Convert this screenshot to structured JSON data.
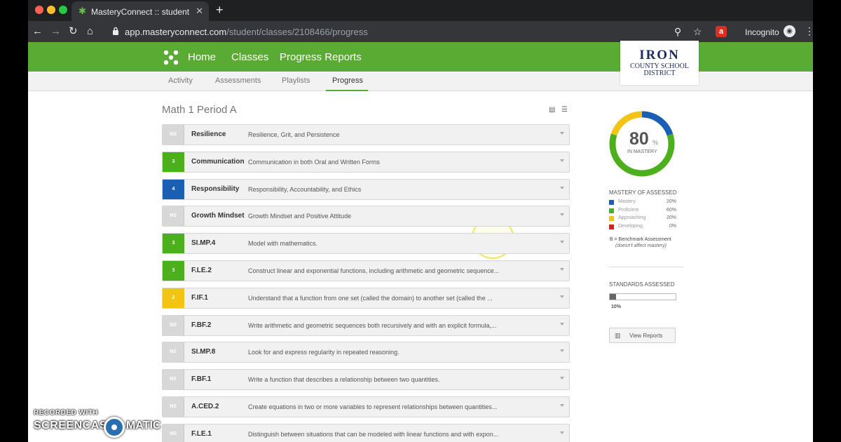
{
  "browser": {
    "tab_title": "MasteryConnect :: student_por",
    "url_host": "app.masteryconnect.com",
    "url_path": "/student/classes/2108466/progress",
    "profile_label": "Incognito"
  },
  "header": {
    "nav": [
      "Home",
      "Classes",
      "Progress Reports"
    ],
    "subnav": [
      "Activity",
      "Assessments",
      "Playlists",
      "Progress"
    ],
    "active_subnav": "Progress",
    "district_logo": {
      "line1": "IRON",
      "line2": "COUNTY SCHOOL",
      "line3": "DISTRICT"
    }
  },
  "main": {
    "class_title": "Math 1 Period A",
    "standards": [
      {
        "badge": "NS",
        "level": "ns",
        "code": "Resilience",
        "desc": "Resilience, Grit, and Persistence"
      },
      {
        "badge": "3",
        "level": "g3",
        "code": "Communication",
        "desc": "Communication in both Oral and Written Forms"
      },
      {
        "badge": "4",
        "level": "b4",
        "code": "Responsibility",
        "desc": "Responsibility, Accountability, and Ethics"
      },
      {
        "badge": "NS",
        "level": "ns",
        "code": "Growth Mindset",
        "desc": "Growth Mindset and Positive Attitude"
      },
      {
        "badge": "3",
        "level": "g3",
        "code": "SI.MP.4",
        "desc": "Model with mathematics."
      },
      {
        "badge": "3",
        "level": "g3",
        "code": "F.LE.2",
        "desc": "Construct linear and exponential functions, including arithmetic and geometric sequence..."
      },
      {
        "badge": "2",
        "level": "y2",
        "code": "F.IF.1",
        "desc": "Understand that a function from one set (called the domain) to another set (called the ..."
      },
      {
        "badge": "NS",
        "level": "ns",
        "code": "F.BF.2",
        "desc": "Write arithmetic and geometric sequences both recursively and with an explicit formula,..."
      },
      {
        "badge": "NS",
        "level": "ns",
        "code": "SI.MP.8",
        "desc": "Look for and express regularity in repeated reasoning."
      },
      {
        "badge": "NS",
        "level": "ns",
        "code": "F.BF.1",
        "desc": "Write a function that describes a relationship between two quantities."
      },
      {
        "badge": "NS",
        "level": "ns",
        "code": "A.CED.2",
        "desc": "Create equations in two or more variables to represent relationships between quantities..."
      },
      {
        "badge": "NS",
        "level": "ns",
        "code": "F.LE.1",
        "desc": "Distinguish between situations that can be modeled with linear functions and with expon..."
      }
    ]
  },
  "panel": {
    "mastery_pct": "80",
    "pct_sign": "%",
    "in_mastery_label": "IN MASTERY",
    "mastery_heading": "MASTERY OF ASSESSED",
    "legend": [
      {
        "label": "Mastery",
        "value": "20%",
        "fraction": 0.2,
        "color": "#1a5fb4"
      },
      {
        "label": "Proficient",
        "value": "60%",
        "fraction": 0.6,
        "color": "#4caf1c"
      },
      {
        "label": "Approaching",
        "value": "20%",
        "fraction": 0.2,
        "color": "#f3c413"
      },
      {
        "label": "Developing",
        "value": "0%",
        "fraction": 0.0,
        "color": "#d62020"
      }
    ],
    "benchmark_note": "B = Benchmark Assessment",
    "benchmark_sub": "(doesn't affect mastery)",
    "standards_heading": "STANDARDS ASSESSED",
    "standards_assessed_value": "10%",
    "standards_assessed_fraction": 0.1,
    "view_reports_label": "View Reports"
  },
  "watermark": {
    "line1": "RECORDED WITH",
    "line2": "SCREENCAST",
    "line3": "MATIC"
  }
}
